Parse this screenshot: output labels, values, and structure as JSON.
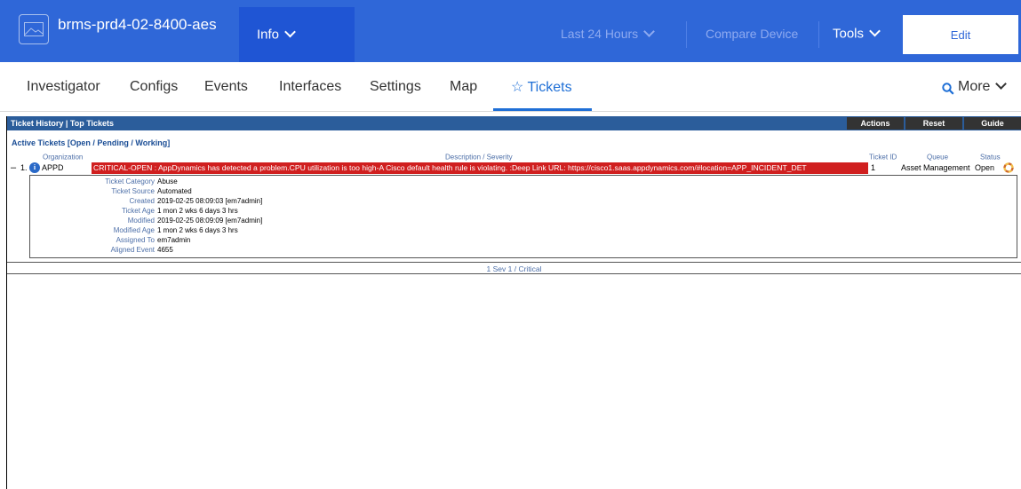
{
  "header": {
    "device_name": "brms-prd4-02-8400-aes",
    "info_label": "Info",
    "time_range": "Last 24 Hours",
    "compare_label": "Compare Device",
    "tools_label": "Tools",
    "edit_label": "Edit",
    "device_icon": "image-icon"
  },
  "nav": {
    "tabs": [
      "Investigator",
      "Configs",
      "Events",
      "Interfaces",
      "Settings",
      "Map",
      "Tickets"
    ],
    "active": "Tickets",
    "more_label": "More"
  },
  "panel": {
    "title": "Ticket History | Top Tickets",
    "buttons": [
      "Actions",
      "Reset",
      "Guide"
    ],
    "section_title": "Active Tickets [Open / Pending / Working]",
    "columns": {
      "organization": "Organization",
      "description": "Description / Severity",
      "ticket_id": "Ticket ID",
      "queue": "Queue",
      "status": "Status"
    },
    "row": {
      "collapse": "–",
      "number": "1.",
      "organization": "APPD",
      "description": "CRITICAL-OPEN : AppDynamics has detected a problem.CPU utilization is too high-A Cisco default health rule is violating. :Deep Link URL: https://cisco1.saas.appdynamics.com/#location=APP_INCIDENT_DET",
      "ticket_id": "1",
      "queue": "Asset Management",
      "status": "Open",
      "severity_color": "#d01f1f"
    },
    "details": [
      {
        "label": "Ticket Category",
        "value": "Abuse"
      },
      {
        "label": "Ticket Source",
        "value": "Automated"
      },
      {
        "label": "Created",
        "value": "2019-02-25 08:09:03 [em7admin]"
      },
      {
        "label": "Ticket Age",
        "value": "1 mon 2 wks 6 days 3 hrs"
      },
      {
        "label": "Modified",
        "value": "2019-02-25 08:09:09 [em7admin]"
      },
      {
        "label": "Modified Age",
        "value": "1 mon 2 wks 6 days 3 hrs"
      },
      {
        "label": "Assigned To",
        "value": "em7admin"
      },
      {
        "label": "Aligned Event",
        "value": "4655"
      }
    ],
    "footer": "1 Sev 1 / Critical"
  },
  "colors": {
    "topbar": "#2f67d8",
    "accent": "#1f6fd6",
    "panel_header": "#2b5d9b",
    "critical": "#d01f1f"
  }
}
